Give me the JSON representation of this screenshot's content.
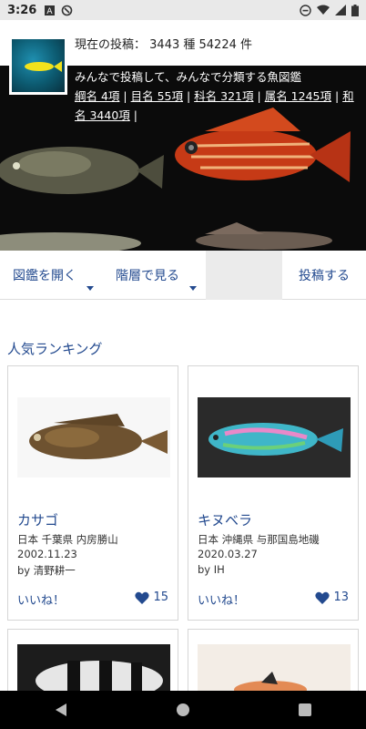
{
  "status_bar": {
    "time": "3:26"
  },
  "header": {
    "post_count_label": "現在の投稿：",
    "post_count_value": "3443 種 54224 件",
    "tagline": "みんなで投稿して、みんなで分類する魚図鑑",
    "taxa_links": [
      {
        "label": "綱名 4項"
      },
      {
        "label": "目名 55項"
      },
      {
        "label": "科名 321項"
      },
      {
        "label": "属名 1245項"
      },
      {
        "label": "和名 3440項"
      }
    ]
  },
  "nav": {
    "open_zukan": "図鑑を開く",
    "by_rank": "階層で見る",
    "post": "投稿する"
  },
  "ranking": {
    "title": "人気ランキング",
    "like_label": "いいね！",
    "cards": [
      {
        "name": "カサゴ",
        "location": "日本 千葉県 内房勝山",
        "date": "2002.11.23",
        "by": "by 清野耕一",
        "likes": "15"
      },
      {
        "name": "キヌベラ",
        "location": "日本 沖縄県 与那国島地磯",
        "date": "2020.03.27",
        "by": "by IH",
        "likes": "13"
      }
    ]
  },
  "colors": {
    "accent": "#234a8f",
    "header_bg": "#0b0b0b"
  }
}
